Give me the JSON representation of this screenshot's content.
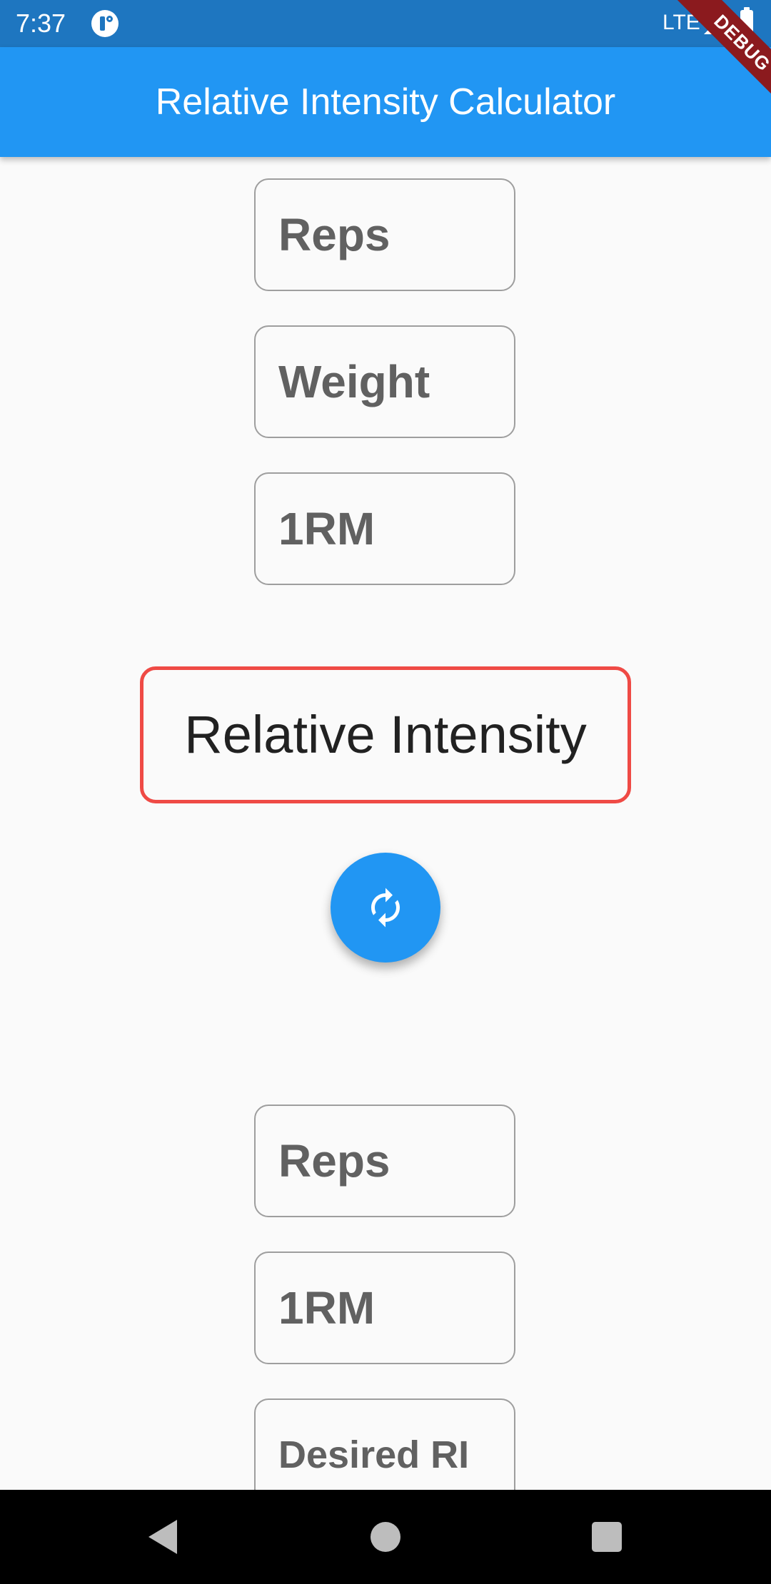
{
  "status_bar": {
    "time": "7:37",
    "network": "LTE",
    "icons": [
      "app-notification-icon",
      "signal-icon",
      "battery-icon"
    ]
  },
  "debug_banner": "DEBUG",
  "app_bar": {
    "title": "Relative Intensity Calculator",
    "color": "#2196f3"
  },
  "calculator_one": {
    "fields": [
      {
        "label": "Reps"
      },
      {
        "label": "Weight"
      },
      {
        "label": "1RM"
      }
    ]
  },
  "result": {
    "text": "Relative Intensity",
    "border_color": "#ef4a45"
  },
  "refresh_button": {
    "icon": "refresh-icon",
    "color": "#2196f3"
  },
  "calculator_two": {
    "fields": [
      {
        "label": "Reps"
      },
      {
        "label": "1RM"
      },
      {
        "label": "Desired RI"
      }
    ]
  },
  "nav_bar": {
    "buttons": [
      "back-icon",
      "home-icon",
      "recents-icon"
    ]
  }
}
